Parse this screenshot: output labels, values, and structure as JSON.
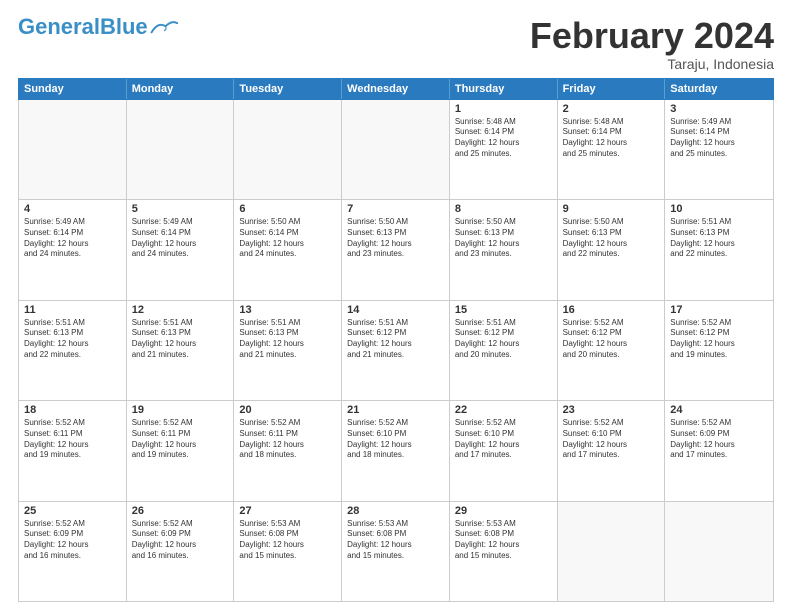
{
  "logo": {
    "part1": "General",
    "part2": "Blue"
  },
  "title": "February 2024",
  "location": "Taraju, Indonesia",
  "header": {
    "days": [
      "Sunday",
      "Monday",
      "Tuesday",
      "Wednesday",
      "Thursday",
      "Friday",
      "Saturday"
    ]
  },
  "weeks": [
    [
      {
        "day": "",
        "info": ""
      },
      {
        "day": "",
        "info": ""
      },
      {
        "day": "",
        "info": ""
      },
      {
        "day": "",
        "info": ""
      },
      {
        "day": "1",
        "info": "Sunrise: 5:48 AM\nSunset: 6:14 PM\nDaylight: 12 hours\nand 25 minutes."
      },
      {
        "day": "2",
        "info": "Sunrise: 5:48 AM\nSunset: 6:14 PM\nDaylight: 12 hours\nand 25 minutes."
      },
      {
        "day": "3",
        "info": "Sunrise: 5:49 AM\nSunset: 6:14 PM\nDaylight: 12 hours\nand 25 minutes."
      }
    ],
    [
      {
        "day": "4",
        "info": "Sunrise: 5:49 AM\nSunset: 6:14 PM\nDaylight: 12 hours\nand 24 minutes."
      },
      {
        "day": "5",
        "info": "Sunrise: 5:49 AM\nSunset: 6:14 PM\nDaylight: 12 hours\nand 24 minutes."
      },
      {
        "day": "6",
        "info": "Sunrise: 5:50 AM\nSunset: 6:14 PM\nDaylight: 12 hours\nand 24 minutes."
      },
      {
        "day": "7",
        "info": "Sunrise: 5:50 AM\nSunset: 6:13 PM\nDaylight: 12 hours\nand 23 minutes."
      },
      {
        "day": "8",
        "info": "Sunrise: 5:50 AM\nSunset: 6:13 PM\nDaylight: 12 hours\nand 23 minutes."
      },
      {
        "day": "9",
        "info": "Sunrise: 5:50 AM\nSunset: 6:13 PM\nDaylight: 12 hours\nand 22 minutes."
      },
      {
        "day": "10",
        "info": "Sunrise: 5:51 AM\nSunset: 6:13 PM\nDaylight: 12 hours\nand 22 minutes."
      }
    ],
    [
      {
        "day": "11",
        "info": "Sunrise: 5:51 AM\nSunset: 6:13 PM\nDaylight: 12 hours\nand 22 minutes."
      },
      {
        "day": "12",
        "info": "Sunrise: 5:51 AM\nSunset: 6:13 PM\nDaylight: 12 hours\nand 21 minutes."
      },
      {
        "day": "13",
        "info": "Sunrise: 5:51 AM\nSunset: 6:13 PM\nDaylight: 12 hours\nand 21 minutes."
      },
      {
        "day": "14",
        "info": "Sunrise: 5:51 AM\nSunset: 6:12 PM\nDaylight: 12 hours\nand 21 minutes."
      },
      {
        "day": "15",
        "info": "Sunrise: 5:51 AM\nSunset: 6:12 PM\nDaylight: 12 hours\nand 20 minutes."
      },
      {
        "day": "16",
        "info": "Sunrise: 5:52 AM\nSunset: 6:12 PM\nDaylight: 12 hours\nand 20 minutes."
      },
      {
        "day": "17",
        "info": "Sunrise: 5:52 AM\nSunset: 6:12 PM\nDaylight: 12 hours\nand 19 minutes."
      }
    ],
    [
      {
        "day": "18",
        "info": "Sunrise: 5:52 AM\nSunset: 6:11 PM\nDaylight: 12 hours\nand 19 minutes."
      },
      {
        "day": "19",
        "info": "Sunrise: 5:52 AM\nSunset: 6:11 PM\nDaylight: 12 hours\nand 19 minutes."
      },
      {
        "day": "20",
        "info": "Sunrise: 5:52 AM\nSunset: 6:11 PM\nDaylight: 12 hours\nand 18 minutes."
      },
      {
        "day": "21",
        "info": "Sunrise: 5:52 AM\nSunset: 6:10 PM\nDaylight: 12 hours\nand 18 minutes."
      },
      {
        "day": "22",
        "info": "Sunrise: 5:52 AM\nSunset: 6:10 PM\nDaylight: 12 hours\nand 17 minutes."
      },
      {
        "day": "23",
        "info": "Sunrise: 5:52 AM\nSunset: 6:10 PM\nDaylight: 12 hours\nand 17 minutes."
      },
      {
        "day": "24",
        "info": "Sunrise: 5:52 AM\nSunset: 6:09 PM\nDaylight: 12 hours\nand 17 minutes."
      }
    ],
    [
      {
        "day": "25",
        "info": "Sunrise: 5:52 AM\nSunset: 6:09 PM\nDaylight: 12 hours\nand 16 minutes."
      },
      {
        "day": "26",
        "info": "Sunrise: 5:52 AM\nSunset: 6:09 PM\nDaylight: 12 hours\nand 16 minutes."
      },
      {
        "day": "27",
        "info": "Sunrise: 5:53 AM\nSunset: 6:08 PM\nDaylight: 12 hours\nand 15 minutes."
      },
      {
        "day": "28",
        "info": "Sunrise: 5:53 AM\nSunset: 6:08 PM\nDaylight: 12 hours\nand 15 minutes."
      },
      {
        "day": "29",
        "info": "Sunrise: 5:53 AM\nSunset: 6:08 PM\nDaylight: 12 hours\nand 15 minutes."
      },
      {
        "day": "",
        "info": ""
      },
      {
        "day": "",
        "info": ""
      }
    ]
  ]
}
